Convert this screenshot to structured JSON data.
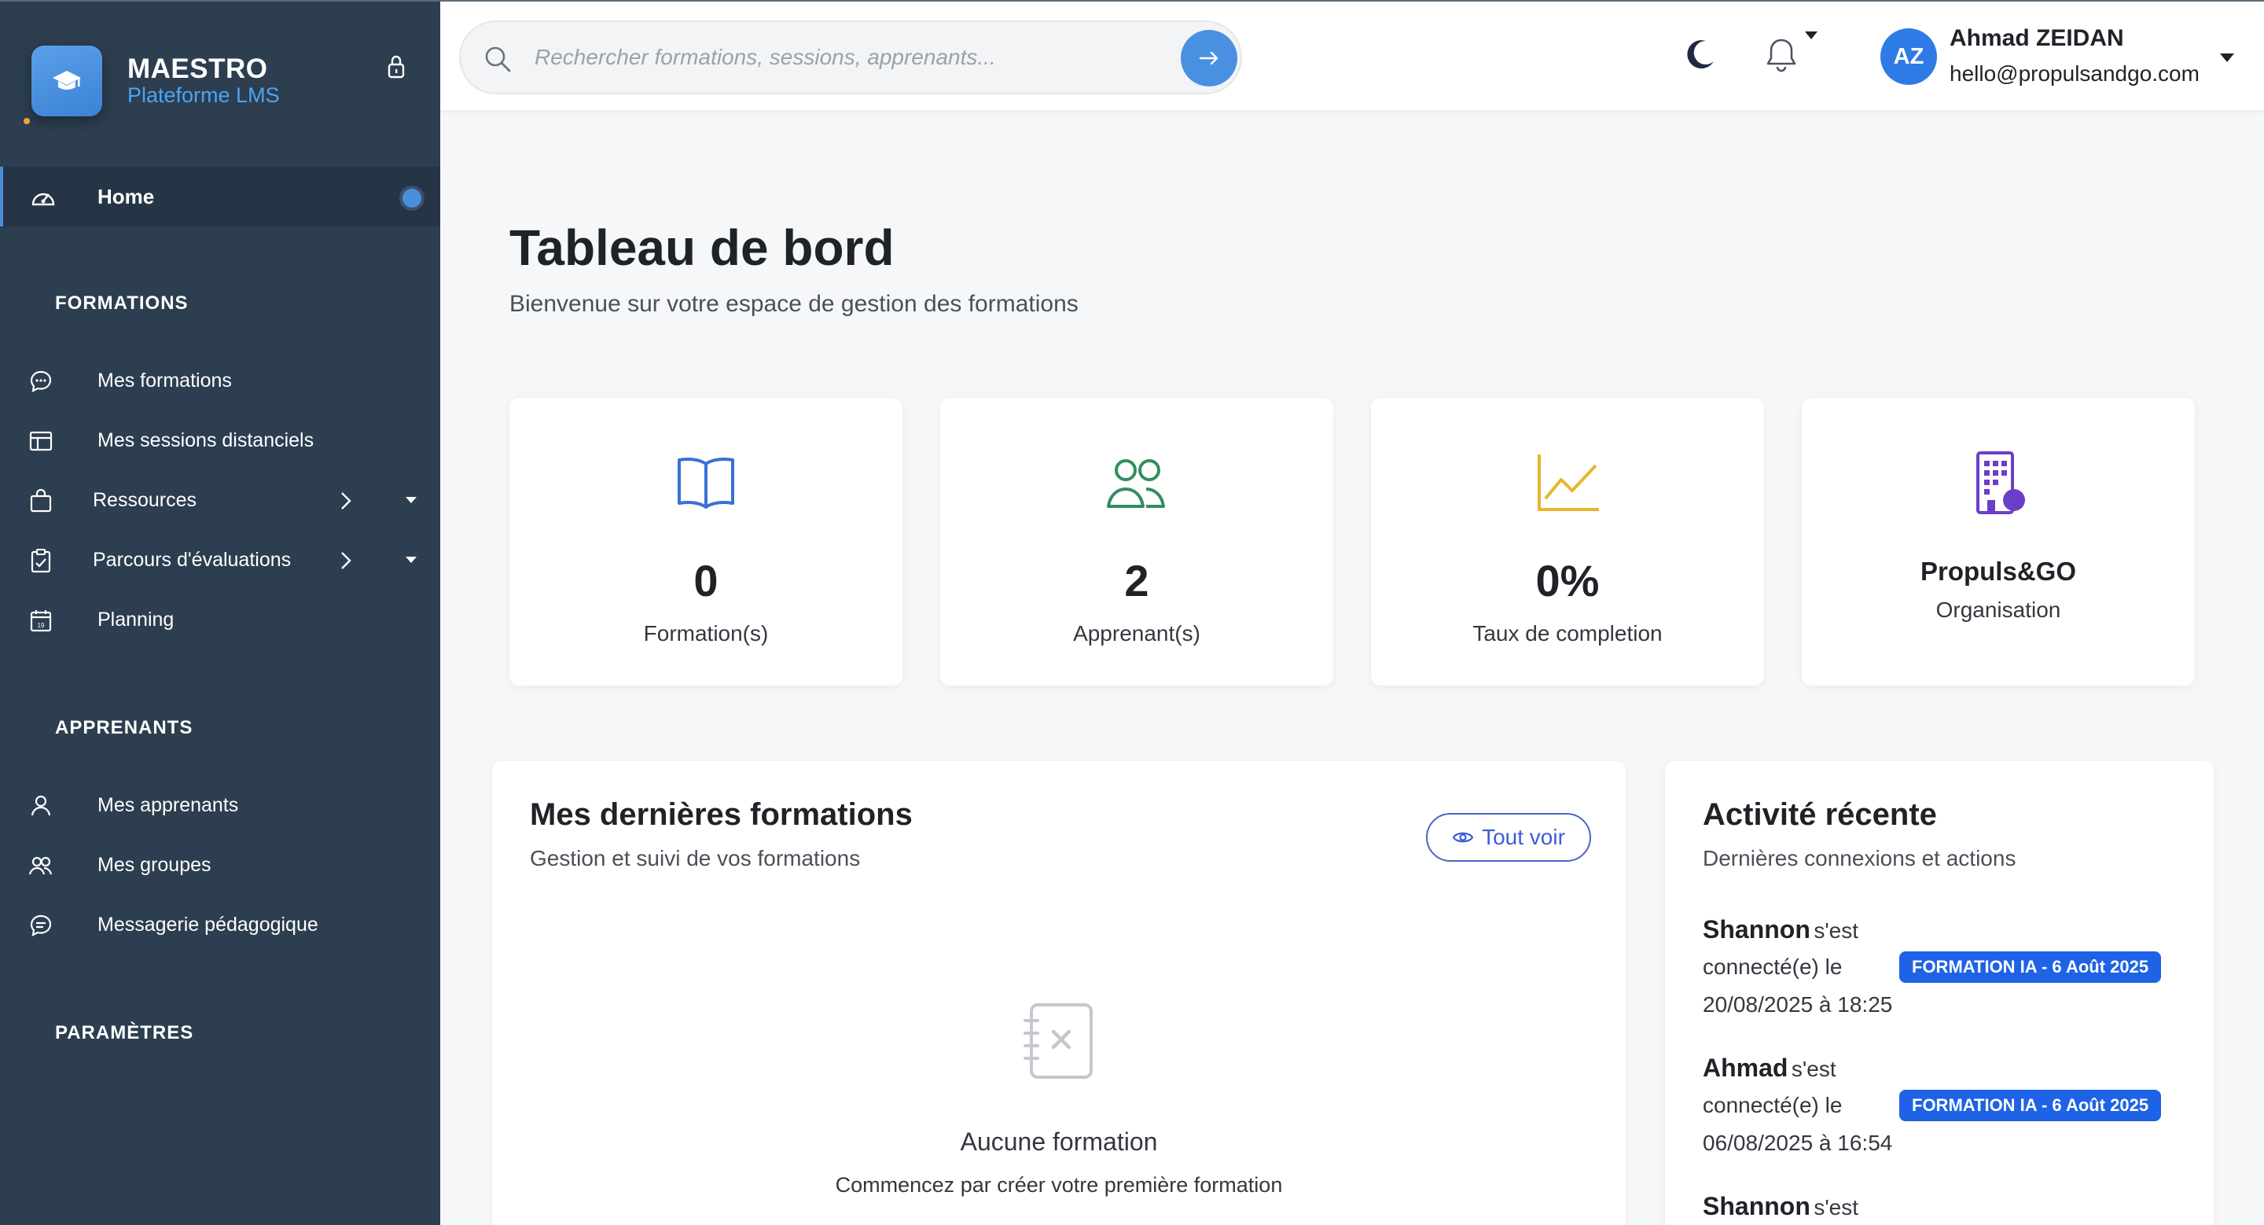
{
  "sidebar": {
    "brand_title": "MAESTRO",
    "brand_subtitle": "Plateforme LMS",
    "home_label": "Home",
    "sections": {
      "formations": "FORMATIONS",
      "apprenants": "APPRENANTS",
      "parametres": "PARAMÈTRES"
    },
    "formations_items": [
      {
        "label": "Mes formations",
        "icon": "chat-bubble-icon"
      },
      {
        "label": "Mes sessions distanciels",
        "icon": "layout-icon"
      },
      {
        "label": "Ressources",
        "icon": "bag-icon"
      },
      {
        "label": "Parcours d'évaluations",
        "icon": "clipboard-icon"
      },
      {
        "label": "Planning",
        "icon": "calendar-icon"
      }
    ],
    "apprenants_items": [
      {
        "label": "Mes apprenants",
        "icon": "user-icon"
      },
      {
        "label": "Mes groupes",
        "icon": "users-icon"
      },
      {
        "label": "Messagerie pédagogique",
        "icon": "message-icon"
      }
    ]
  },
  "topbar": {
    "search_placeholder": "Rechercher formations, sessions, apprenants...",
    "user_initials": "AZ",
    "user_name": "Ahmad ZEIDAN",
    "user_email": "hello@propulsandgo.com"
  },
  "main": {
    "title": "Tableau de bord",
    "subtitle": "Bienvenue sur votre espace de gestion des formations",
    "stats": [
      {
        "value": "0",
        "label": "Formation(s)",
        "icon": "book-icon",
        "color": "#3b6fd8"
      },
      {
        "value": "2",
        "label": "Apprenant(s)",
        "icon": "users-icon",
        "color": "#2f8f5b"
      },
      {
        "value": "0%",
        "label": "Taux de completion",
        "icon": "chart-line-icon",
        "color": "#e8b52e"
      },
      {
        "value": "Propuls&GO",
        "label": "Organisation",
        "icon": "building-icon",
        "color": "#6a3fc8"
      }
    ],
    "formations_panel": {
      "title": "Mes dernières formations",
      "subtitle": "Gestion et suivi de vos formations",
      "view_all": "Tout voir",
      "empty_title": "Aucune formation",
      "empty_subtitle": "Commencez par créer votre première formation"
    },
    "activity_panel": {
      "title": "Activité récente",
      "subtitle": "Dernières connexions et actions",
      "items": [
        {
          "name": "Shannon",
          "action": "s'est",
          "line2": "connecté(e) le",
          "line3": "20/08/2025 à 18:25",
          "badge": "FORMATION IA - 6 Août 2025"
        },
        {
          "name": "Ahmad",
          "action": "s'est",
          "line2": "connecté(e) le",
          "line3": "06/08/2025 à 16:54",
          "badge": "FORMATION IA - 6 Août 2025"
        },
        {
          "name": "Shannon",
          "action": "s'est"
        }
      ]
    }
  }
}
